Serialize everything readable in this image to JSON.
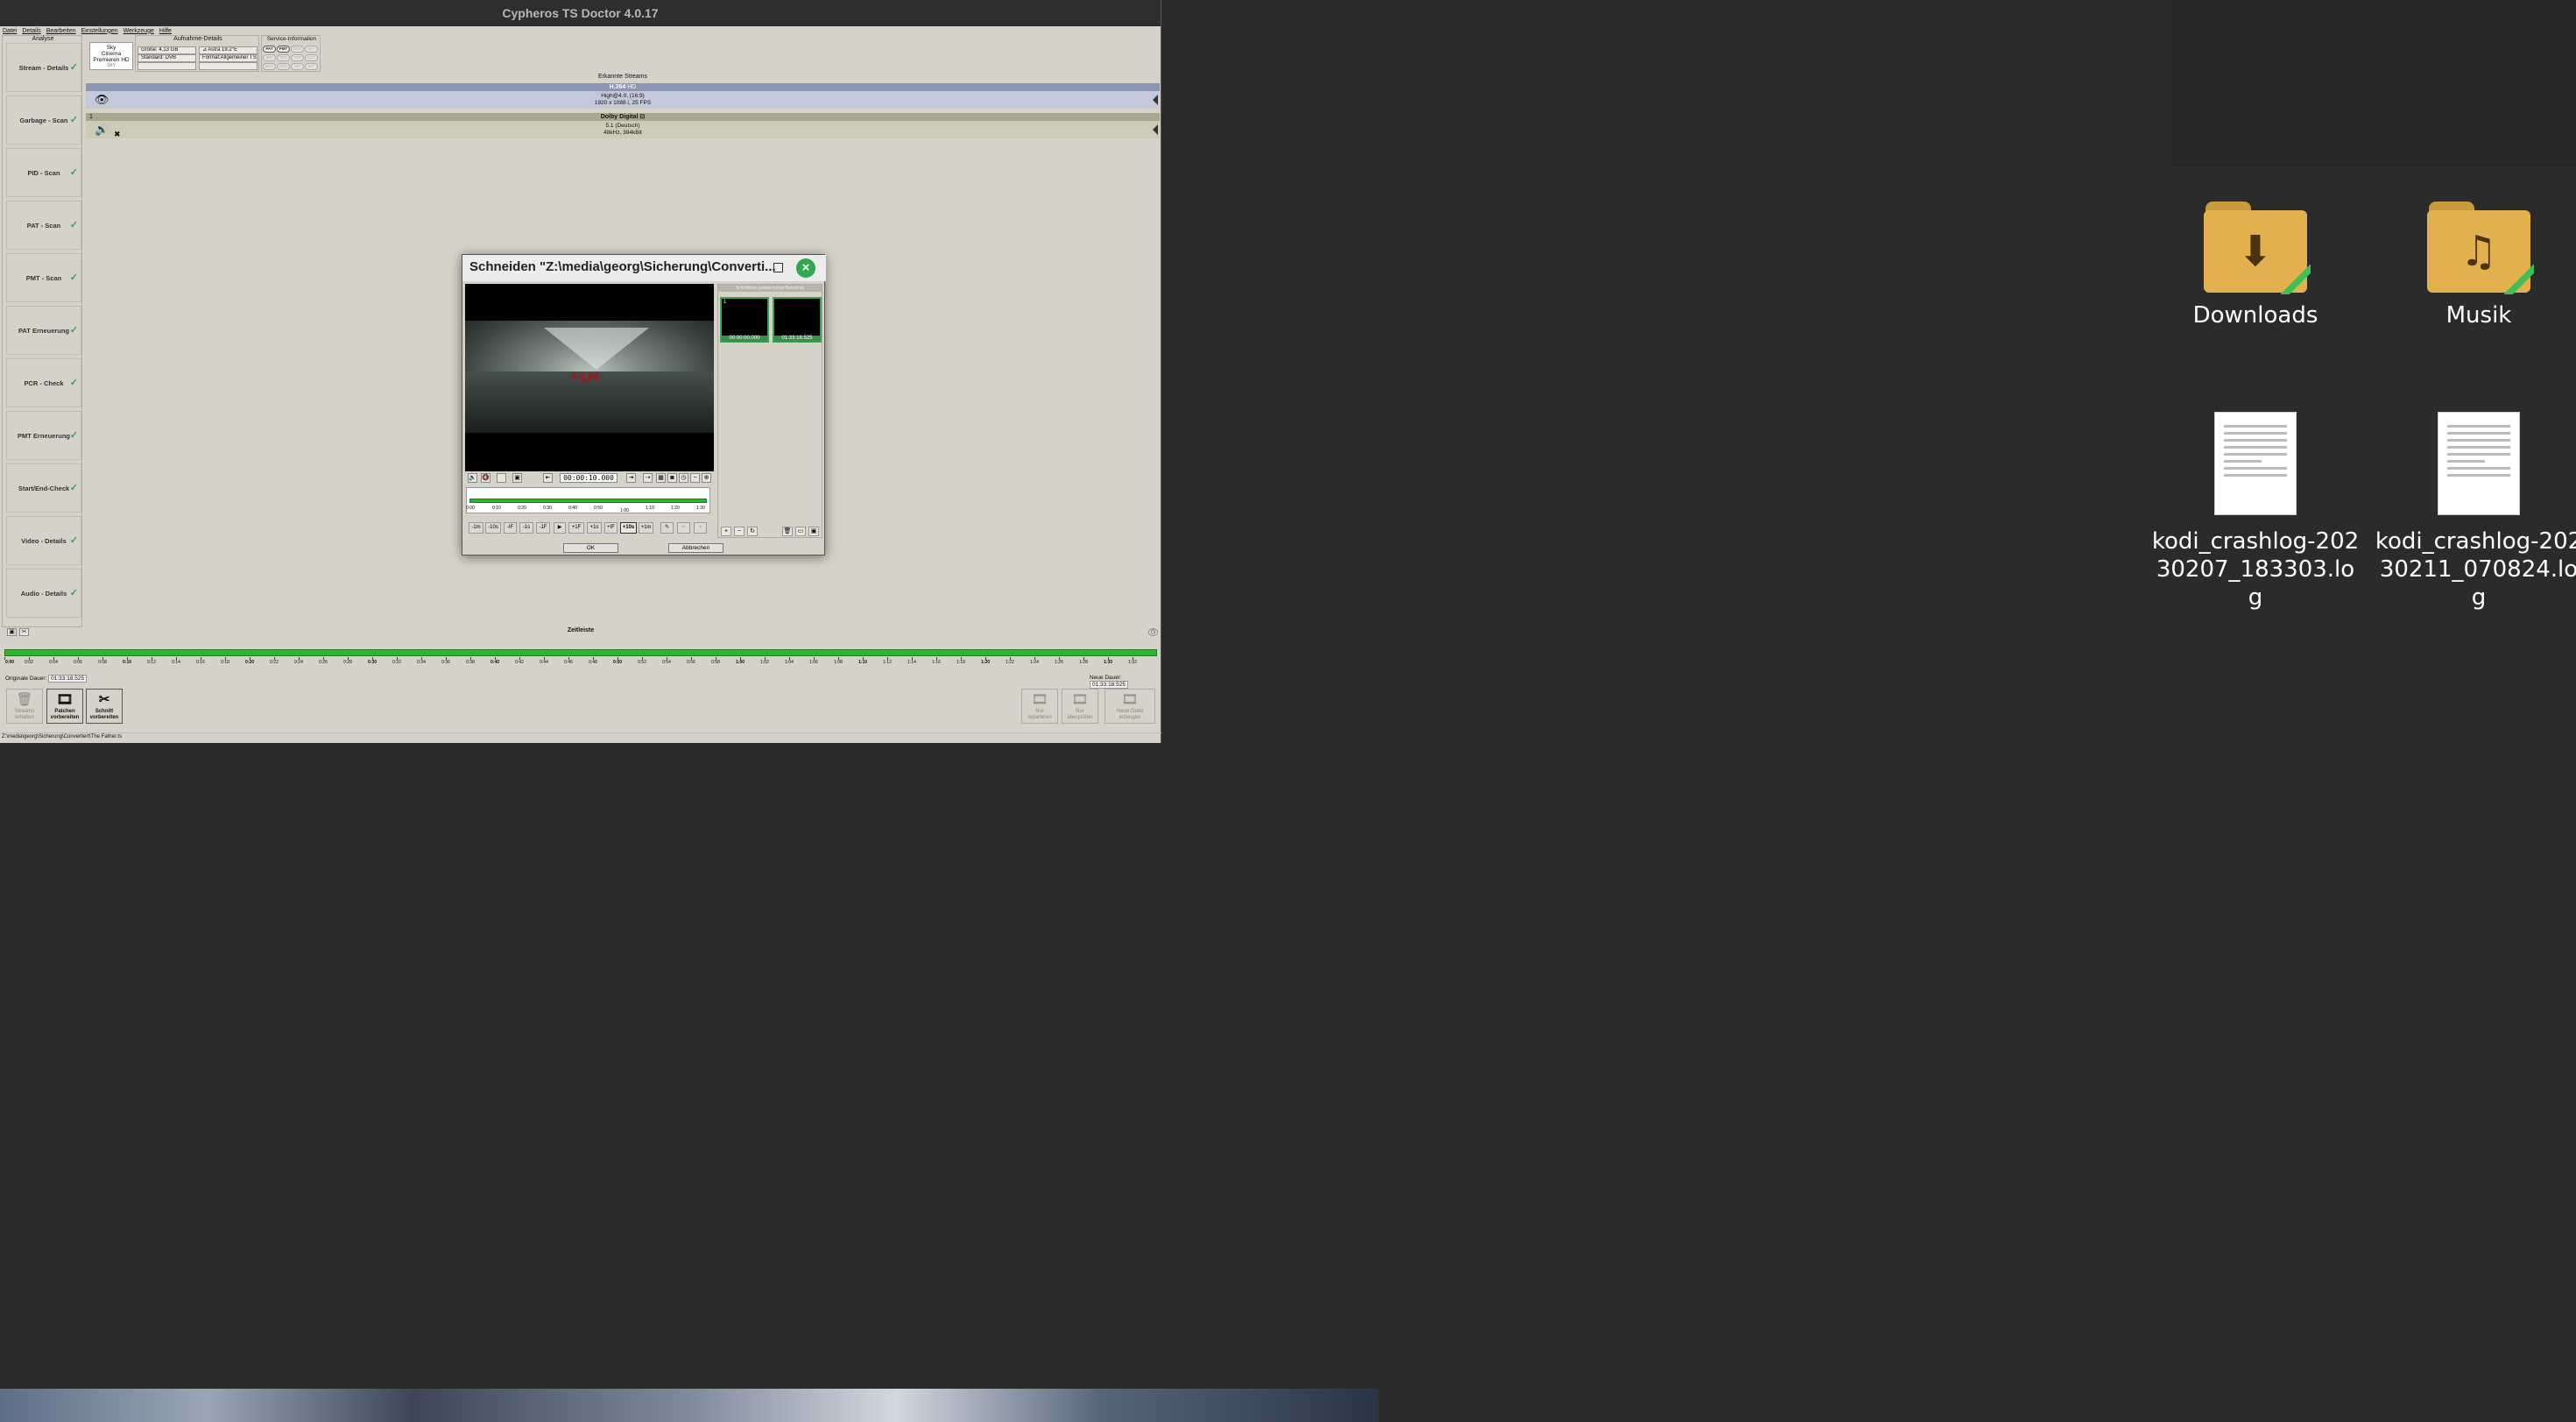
{
  "desktop": {
    "icons": [
      {
        "label": "Downloads",
        "type": "folder",
        "glyph": "⬇"
      },
      {
        "label": "Musik",
        "type": "folder",
        "glyph": "♫"
      },
      {
        "label": "kodi_crashlog-20230207_183303.log",
        "type": "file"
      },
      {
        "label": "kodi_crashlog-20230211_070824.log",
        "type": "file"
      }
    ]
  },
  "app": {
    "title": "Cypheros TS Doctor 4.0.17",
    "menu": [
      "Datei",
      "Details",
      "Bearbeiten",
      "Einstellungen",
      "Werkzeuge",
      "Hilfe"
    ]
  },
  "analysis": {
    "title": "Analyse",
    "items": [
      "Stream - Details",
      "Garbage - Scan",
      "PID - Scan",
      "PAT - Scan",
      "PMT - Scan",
      "PAT Erneuerung",
      "PCR - Check",
      "PMT Erneuerung",
      "Start/End-Check",
      "Video - Details",
      "Audio - Details"
    ],
    "check_glyph": "✓"
  },
  "header": {
    "sender": {
      "line1": "Sky",
      "line2": "Cinema",
      "line3": "Premieren HD",
      "sub": "SKY"
    },
    "aufnahme": {
      "title": "Aufnahme-Details",
      "groesse": "Größe:  4,13 GB",
      "standard": "Standard: DVB",
      "satellite": "Astra 19.2°E",
      "format": "Format:Allgemeiner TS"
    },
    "service": {
      "title": "Service-Information",
      "tags": [
        "PAT",
        "PMT",
        "SDT",
        "NIT",
        "EIT",
        "TDT",
        "TOT",
        "CAT",
        "BAT",
        "RST",
        "SIT",
        "DIT"
      ],
      "active": [
        "PAT",
        "PMT"
      ]
    }
  },
  "streams": {
    "title": "Erkannte Streams",
    "video": {
      "codec": "H.264",
      "badge": "HD",
      "line1": "High@4.0, (16:9)",
      "line2": "1920 x 1088 i, 25 FPS"
    },
    "audio": {
      "index": "1",
      "codec": "Dolby Digital",
      "line1": "5.1 (Deutsch)",
      "line2": "48kHz, 384kBit"
    },
    "colors": {
      "video_head": "#8b96b6",
      "video_row": "#c3c8da",
      "audio_head": "#a8a890",
      "audio_row": "#cdcbb7"
    }
  },
  "timeline": {
    "title": "Zeitleiste",
    "ticks": [
      "0:00",
      "0:02",
      "0:04",
      "0:06",
      "0:08",
      "0:10",
      "0:12",
      "0:14",
      "0:16",
      "0:18",
      "0:20",
      "0:22",
      "0:24",
      "0:26",
      "0:28",
      "0:30",
      "0:32",
      "0:34",
      "0:36",
      "0:38",
      "0:40",
      "0:42",
      "0:44",
      "0:46",
      "0:48",
      "0:50",
      "0:52",
      "0:54",
      "0:56",
      "0:58",
      "1:00",
      "1:02",
      "1:04",
      "1:06",
      "1:08",
      "1:10",
      "1:12",
      "1:14",
      "1:16",
      "1:18",
      "1:20",
      "1:22",
      "1:24",
      "1:26",
      "1:28",
      "1:30",
      "1:32"
    ]
  },
  "durations": {
    "original_label": "Originale Dauer:",
    "original_value": "01:33:18.525",
    "new_label": "Neue Dauer:",
    "new_value": "01:33:18.525"
  },
  "actions": {
    "left": [
      {
        "line1": "Streams",
        "line2": "erhalten",
        "glyph": "🗑",
        "state": "disabled"
      },
      {
        "line1": "Patchen",
        "line2": "vorbereiten",
        "glyph": "🎞",
        "state": "active"
      },
      {
        "line1": "Schnitt",
        "line2": "vorbereiten",
        "glyph": "✂",
        "state": "active"
      }
    ],
    "right": [
      {
        "line1": "Nur",
        "line2": "reparieren",
        "glyph": "🎞",
        "state": "disabled"
      },
      {
        "line1": "Nur",
        "line2": "überprüfen",
        "glyph": "🎞",
        "state": "disabled"
      },
      {
        "line1": "Neue Datei",
        "line2": "erzeugen",
        "glyph": "🎞",
        "state": "disabled"
      }
    ]
  },
  "statusbar": {
    "path": "Z:\\media\\georg\\Sicherung\\Convertiert\\The Father.ts"
  },
  "dialog": {
    "title": "Schneiden \"Z:\\media\\georg\\Sicherung\\Converti...",
    "video_logo": "FILM",
    "timecode": "00:00:10.000",
    "track_labels": [
      "0:00",
      "0:10",
      "0:20",
      "0:30",
      "0:40",
      "0:50",
      "1:00",
      "1:10",
      "1:20",
      "1:30"
    ],
    "step_buttons": [
      "-1m",
      "-10s",
      "-IF",
      "-1s",
      "-1F",
      "▶",
      "+1F",
      "+1s",
      "+IF",
      "+10s",
      "+1m"
    ],
    "selected_step": "+10s",
    "cutlist_title": "Schnittliste (wiederzuhier Bereiche)",
    "cutlist": [
      {
        "index": "1",
        "time": "00:00:00.000"
      },
      {
        "index": "",
        "time": "01:33:18.525"
      }
    ],
    "ok_label": "OK",
    "cancel_label": "Abbrechen"
  }
}
